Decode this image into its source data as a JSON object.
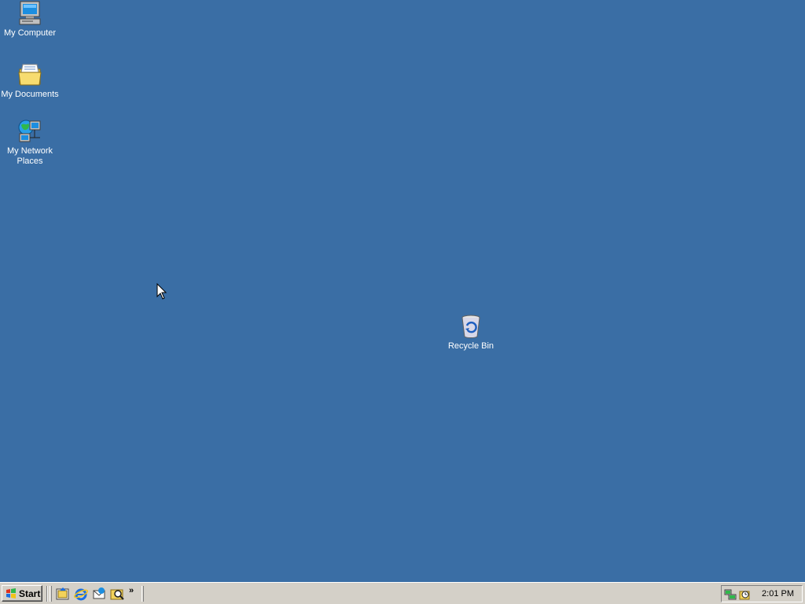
{
  "desktop": {
    "background_color": "#3a6ea5",
    "icons": [
      {
        "label": "My Computer",
        "icon": "computer-icon"
      },
      {
        "label": "My Documents",
        "icon": "folder-documents-icon"
      },
      {
        "label": "My Network Places",
        "icon": "network-places-icon"
      },
      {
        "label": "Recycle Bin",
        "icon": "recycle-bin-icon"
      }
    ]
  },
  "taskbar": {
    "start_label": "Start",
    "quick_launch": [
      {
        "icon": "show-desktop-icon"
      },
      {
        "icon": "internet-explorer-icon"
      },
      {
        "icon": "outlook-express-icon"
      },
      {
        "icon": "windows-explorer-icon"
      }
    ],
    "more_chevron": "»",
    "tray_icons": [
      {
        "icon": "network-connection-icon"
      },
      {
        "icon": "scheduled-task-icon"
      }
    ],
    "clock": "2:01 PM"
  }
}
